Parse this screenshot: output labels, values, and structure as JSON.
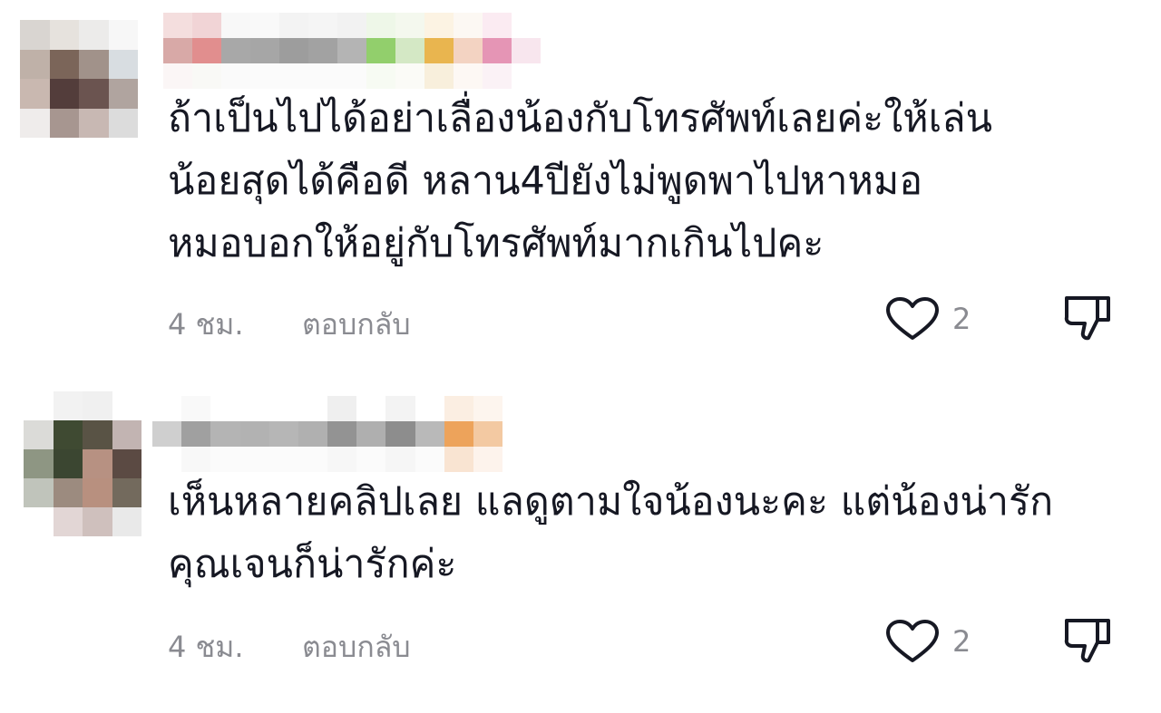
{
  "comments": [
    {
      "text": "ถ้าเป็นไปได้อย่าเลื่องน้องกับโทรศัพท์เลยค่ะให้เล่น\nน้อยสุดได้คือดี หลาน4ปียังไม่พูดพาไปหาหมอ\nหมอบอกให้อยู่กับโทรศัพท์มากเกินไปคะ",
      "time": "4 ชม.",
      "reply_label": "ตอบกลับ",
      "likes": "2"
    },
    {
      "text": "เห็นหลายคลิปเลย แลดูตามใจน้องนะคะ แต่น้องน่ารัก\nคุณเจนก็น่ารักค่ะ",
      "time": "4 ชม.",
      "reply_label": "ตอบกลับ",
      "likes": "2"
    }
  ],
  "icons": {
    "like": "heart-outline-icon",
    "dislike": "thumbs-down-outline-icon"
  },
  "colors": {
    "text": "#161823",
    "secondary": "#8a8b91",
    "icon": "#161823"
  }
}
